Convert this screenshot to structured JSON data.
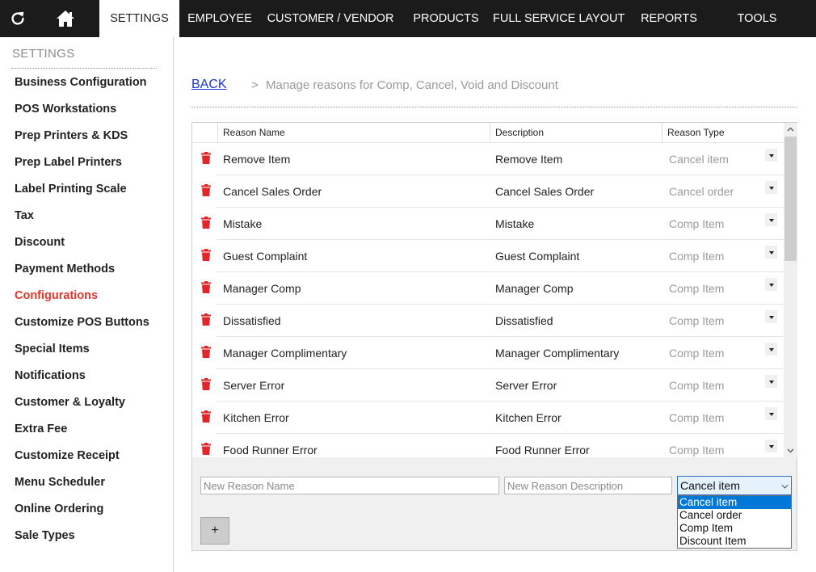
{
  "nav": {
    "refresh_icon": "refresh-icon",
    "home_icon": "home-icon",
    "tabs": [
      "SETTINGS",
      "EMPLOYEE",
      "CUSTOMER / VENDOR",
      "PRODUCTS",
      "FULL SERVICE LAYOUT",
      "REPORTS",
      "TOOLS"
    ],
    "active_tab": "SETTINGS"
  },
  "sidebar": {
    "title": "SETTINGS",
    "items": [
      "Business Configuration",
      "POS Workstations",
      "Prep Printers & KDS",
      "Prep Label Printers",
      "Label Printing Scale",
      "Tax",
      "Discount",
      "Payment Methods",
      "Configurations",
      "Customize POS Buttons",
      "Special Items",
      "Notifications",
      "Customer & Loyalty",
      "Extra Fee",
      "Customize Receipt",
      "Menu Scheduler",
      "Online Ordering",
      "Sale Types"
    ],
    "active_item": "Configurations"
  },
  "breadcrumb": {
    "back": "BACK",
    "separator": ">",
    "current": "Manage reasons for Comp, Cancel, Void and Discount"
  },
  "grid": {
    "columns": [
      "Reason Name",
      "Description",
      "Reason Type"
    ],
    "rows": [
      {
        "name": "Remove Item",
        "description": "Remove Item",
        "type": "Cancel item"
      },
      {
        "name": "Cancel Sales Order",
        "description": "Cancel Sales Order",
        "type": "Cancel order"
      },
      {
        "name": "Mistake",
        "description": "Mistake",
        "type": "Comp Item"
      },
      {
        "name": "Guest Complaint",
        "description": "Guest Complaint",
        "type": "Comp Item"
      },
      {
        "name": "Manager Comp",
        "description": "Manager Comp",
        "type": "Comp Item"
      },
      {
        "name": "Dissatisfied",
        "description": "Dissatisfied",
        "type": "Comp Item"
      },
      {
        "name": "Manager Complimentary",
        "description": "Manager Complimentary",
        "type": "Comp Item"
      },
      {
        "name": "Server Error",
        "description": "Server Error",
        "type": "Comp Item"
      },
      {
        "name": "Kitchen Error",
        "description": "Kitchen Error",
        "type": "Comp Item"
      },
      {
        "name": "Food Runner Error",
        "description": "Food Runner Error",
        "type": "Comp Item"
      }
    ]
  },
  "add_form": {
    "name_placeholder": "New Reason Name",
    "description_placeholder": "New Reason Description",
    "selected_type": "Cancel item",
    "type_options": [
      "Cancel item",
      "Cancel order",
      "Comp Item",
      "Discount Item"
    ],
    "add_label": "+"
  },
  "colors": {
    "nav_bg": "#1b1b1b",
    "active_link": "#e0362b",
    "trash": "#e3242b",
    "link_blue": "#1a35d9",
    "selection_blue": "#0078d7"
  }
}
